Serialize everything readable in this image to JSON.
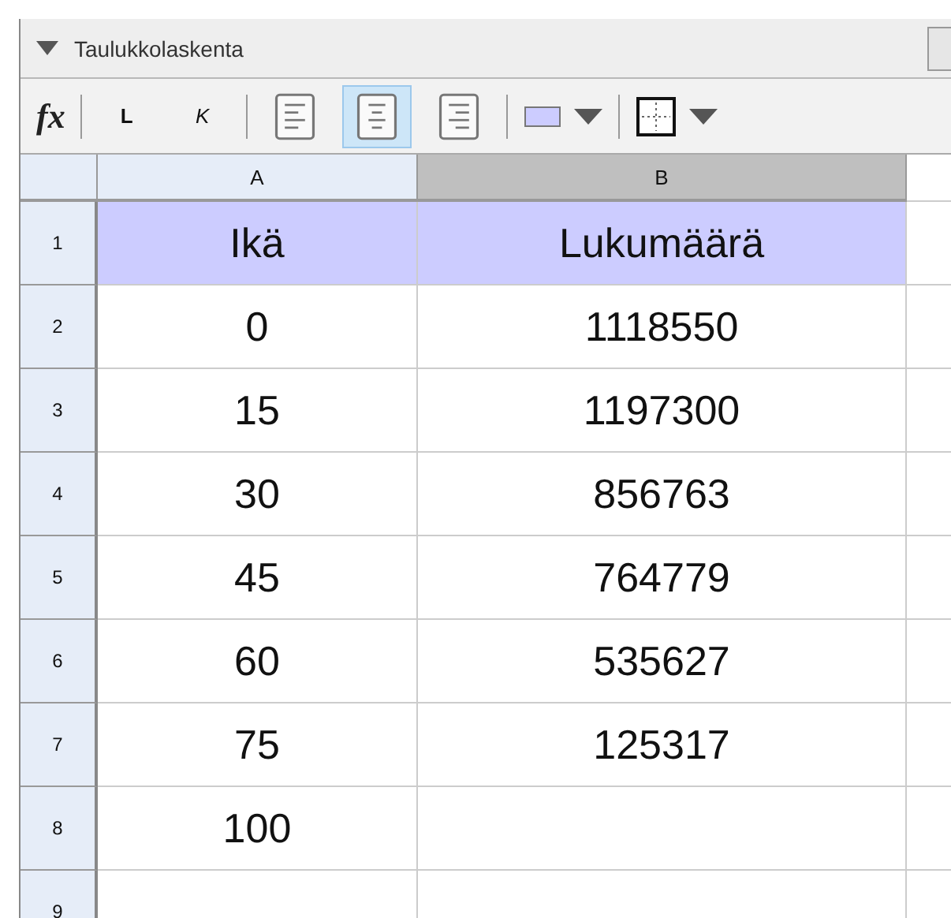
{
  "panel": {
    "title": "Taulukkolaskenta"
  },
  "toolbar": {
    "fx": "fx",
    "bold": "L",
    "italic": "K",
    "align": [
      {
        "kind": "left",
        "selected": false
      },
      {
        "kind": "center",
        "selected": true
      },
      {
        "kind": "right",
        "selected": false
      }
    ]
  },
  "table": {
    "columns": [
      {
        "label": "A",
        "selected": false
      },
      {
        "label": "B",
        "selected": true
      }
    ],
    "rows": [
      {
        "number": "1",
        "highlighted": true,
        "cells": [
          "Ikä",
          "Lukumäärä"
        ]
      },
      {
        "number": "2",
        "highlighted": false,
        "cells": [
          "0",
          "1118550"
        ]
      },
      {
        "number": "3",
        "highlighted": false,
        "cells": [
          "15",
          "1197300"
        ]
      },
      {
        "number": "4",
        "highlighted": false,
        "cells": [
          "30",
          "856763"
        ]
      },
      {
        "number": "5",
        "highlighted": false,
        "cells": [
          "45",
          "764779"
        ]
      },
      {
        "number": "6",
        "highlighted": false,
        "cells": [
          "60",
          "535627"
        ]
      },
      {
        "number": "7",
        "highlighted": false,
        "cells": [
          "75",
          "125317"
        ]
      },
      {
        "number": "8",
        "highlighted": false,
        "cells": [
          "100",
          ""
        ]
      },
      {
        "number": "9",
        "highlighted": false,
        "cells": [
          "",
          ""
        ]
      }
    ]
  }
}
